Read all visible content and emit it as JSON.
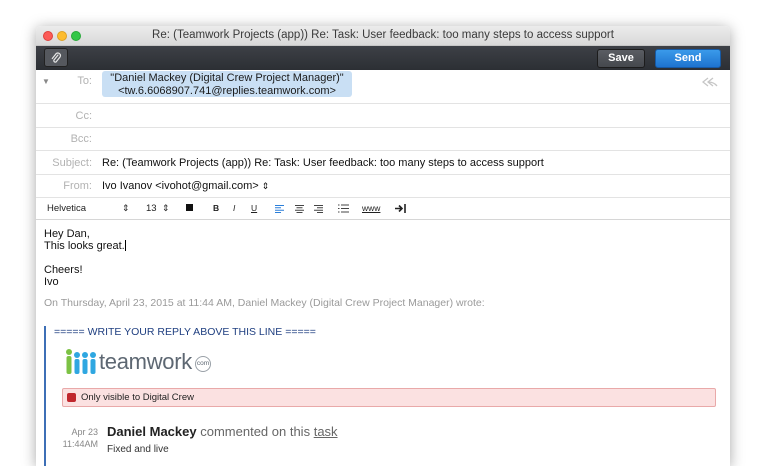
{
  "window": {
    "title": "Re: (Teamwork Projects (app)) Re: Task: User feedback: too many steps to access support"
  },
  "toolbar": {
    "save_label": "Save",
    "send_label": "Send"
  },
  "header": {
    "to_label": "To:",
    "to_name": "\"Daniel Mackey (Digital Crew Project Manager)\"",
    "to_address": "<tw.6.6068907.741@replies.teamwork.com>",
    "cc_label": "Cc:",
    "bcc_label": "Bcc:",
    "subject_label": "Subject:",
    "subject_value": "Re: (Teamwork Projects (app)) Re: Task: User feedback: too many steps to access support",
    "from_label": "From:",
    "from_value": "Ivo Ivanov <ivohot@gmail.com>"
  },
  "format": {
    "font": "Helvetica",
    "size": "13",
    "bold": "B",
    "italic": "I",
    "underline": "U",
    "link": "www"
  },
  "message": {
    "greeting": "Hey Dan,",
    "line1": "This looks great.",
    "signoff": "Cheers!",
    "signature": "Ivo"
  },
  "quoted": {
    "attribution": "On Thursday, April 23, 2015 at 11:44 AM, Daniel Mackey (Digital Crew Project Manager) wrote:",
    "reply_marker": "===== WRITE YOUR REPLY ABOVE THIS LINE =====",
    "logo_text": "teamwork",
    "logo_suffix": "com",
    "visibility_notice": "Only visible to Digital Crew",
    "comment_date": "Apr 23",
    "comment_time": "11:44AM",
    "comment_author": "Daniel Mackey",
    "comment_action": "commented on this",
    "comment_link": "task",
    "comment_body": "Fixed and live"
  },
  "colors": {
    "accent": "#2b7fd9",
    "quote_bar": "#3d6fb6",
    "notice_bg": "#fbe1e1"
  }
}
